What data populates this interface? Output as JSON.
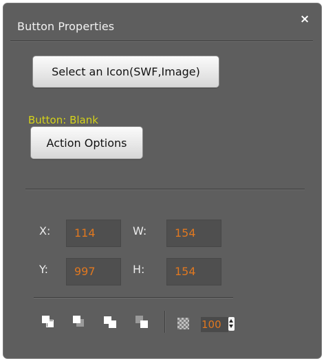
{
  "window": {
    "title": "Button Properties",
    "close_glyph": "×"
  },
  "buttons": {
    "select_icon": "Select an Icon(SWF,Image)",
    "action_options": "Action Options"
  },
  "status": {
    "button_label": "Button: Blank"
  },
  "geometry": {
    "x_label": "X:",
    "x_value": "114",
    "w_label": "W:",
    "w_value": "154",
    "y_label": "Y:",
    "y_value": "997",
    "h_label": "H:",
    "h_value": "154"
  },
  "toolbar": {
    "icons": [
      "bring-to-front-icon",
      "bring-forward-icon",
      "send-backward-icon",
      "send-to-back-icon",
      "transparency-icon",
      "spinner-icon"
    ],
    "opacity_value": "100"
  },
  "colors": {
    "panel_bg": "#5e5e5e",
    "status_text": "#d4d21a",
    "value_text": "#e07820"
  }
}
